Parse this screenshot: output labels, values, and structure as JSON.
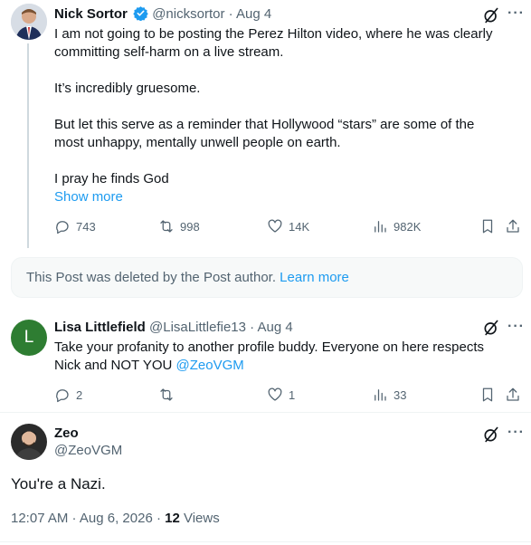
{
  "post1": {
    "name": "Nick Sortor",
    "handle": "@nicksortor",
    "date": "Aug 4",
    "lines": [
      "I am not going to be posting the Perez Hilton video, where he was clearly",
      "committing self-harm on a live stream.",
      "It’s incredibly gruesome.",
      "But let this serve as a reminder that Hollywood “stars” are some of the",
      "most unhappy, mentally unwell people on earth.",
      "I pray he finds God"
    ],
    "show_more": "Show more",
    "replies": "743",
    "reposts": "998",
    "likes": "14K",
    "views": "982K",
    "verified_color": "#1d9bf0"
  },
  "deleted": {
    "text": "This Post was deleted by the Post author.",
    "link": "Learn more"
  },
  "post2": {
    "name": "Lisa Littlefield",
    "handle": "@LisaLittlefie13",
    "date": "Aug 4",
    "avatar_letter": "L",
    "avatar_color": "#2e7d32",
    "line1": "Take your profanity to another profile buddy.  Everyone on here respects",
    "line2": "Nick and NOT YOU",
    "mention": "@ZeoVGM",
    "replies": "2",
    "reposts": "",
    "likes": "1",
    "views": "33"
  },
  "post3": {
    "name": "Zeo",
    "handle": "@ZeoVGM",
    "text": "You're a Nazi.",
    "timestamp": "12:07 AM · Aug 6, 2026 · ",
    "views_count": "12",
    "views_label": " Views"
  },
  "icons": {
    "more": "more-icon",
    "grok": "grok-icon",
    "reply": "reply-icon",
    "repost": "repost-icon",
    "like": "like-icon",
    "views": "views-icon",
    "bookmark": "bookmark-icon",
    "share": "share-icon"
  },
  "link_color": "#1d9bf0"
}
